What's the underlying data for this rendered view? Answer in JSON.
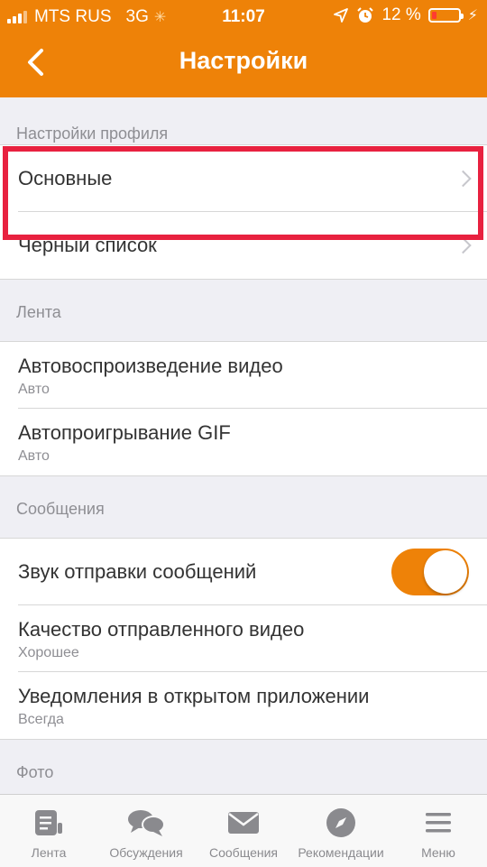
{
  "status_bar": {
    "carrier": "MTS RUS",
    "network": "3G",
    "time": "11:07",
    "battery": "12 %"
  },
  "header": {
    "title": "Настройки"
  },
  "sections": {
    "profile": {
      "header": "Настройки профиля",
      "items": [
        {
          "title": "Основные"
        },
        {
          "title": "Чёрный список"
        }
      ]
    },
    "feed": {
      "header": "Лента",
      "items": [
        {
          "title": "Автовоспроизведение видео",
          "value": "Авто"
        },
        {
          "title": "Автопроигрывание GIF",
          "value": "Авто"
        }
      ]
    },
    "messages": {
      "header": "Сообщения",
      "items": [
        {
          "title": "Звук отправки сообщений",
          "toggle": true
        },
        {
          "title": "Качество отправленного видео",
          "value": "Хорошее"
        },
        {
          "title": "Уведомления в открытом приложении",
          "value": "Всегда"
        }
      ]
    },
    "photo": {
      "header": "Фото"
    }
  },
  "tabbar": {
    "items": [
      {
        "label": "Лента",
        "icon": "feed-icon"
      },
      {
        "label": "Обсуждения",
        "icon": "discussions-icon"
      },
      {
        "label": "Сообщения",
        "icon": "mail-icon"
      },
      {
        "label": "Рекомендации",
        "icon": "compass-icon"
      },
      {
        "label": "Меню",
        "icon": "menu-icon"
      }
    ]
  },
  "colors": {
    "accent": "#ee8208",
    "highlight": "#e8213f"
  }
}
